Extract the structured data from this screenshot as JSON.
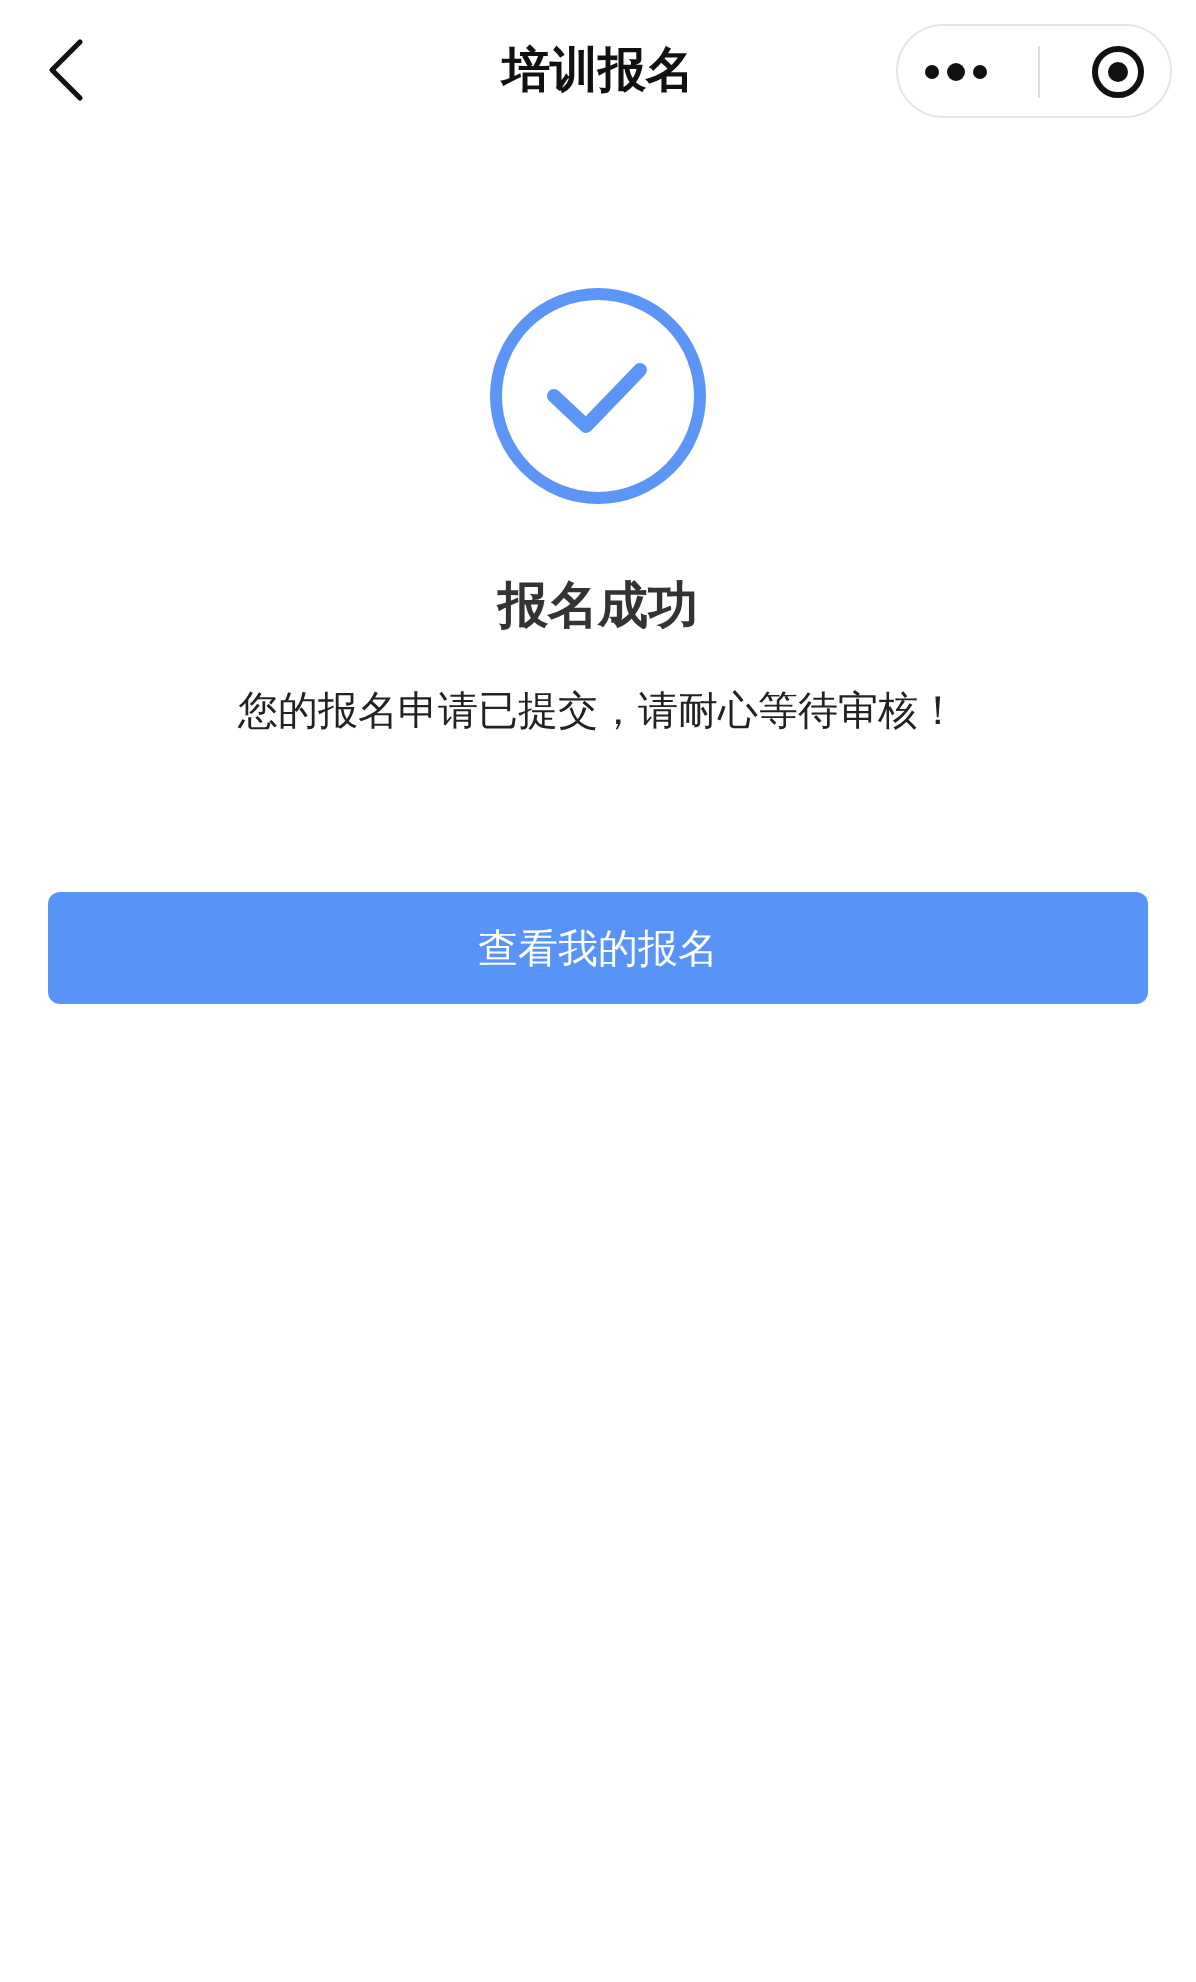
{
  "nav_bar": {
    "title": "培训报名"
  },
  "result": {
    "title": "报名成功",
    "message": "您的报名申请已提交，请耐心等待审核！"
  },
  "button": {
    "label": "查看我的报名"
  }
}
